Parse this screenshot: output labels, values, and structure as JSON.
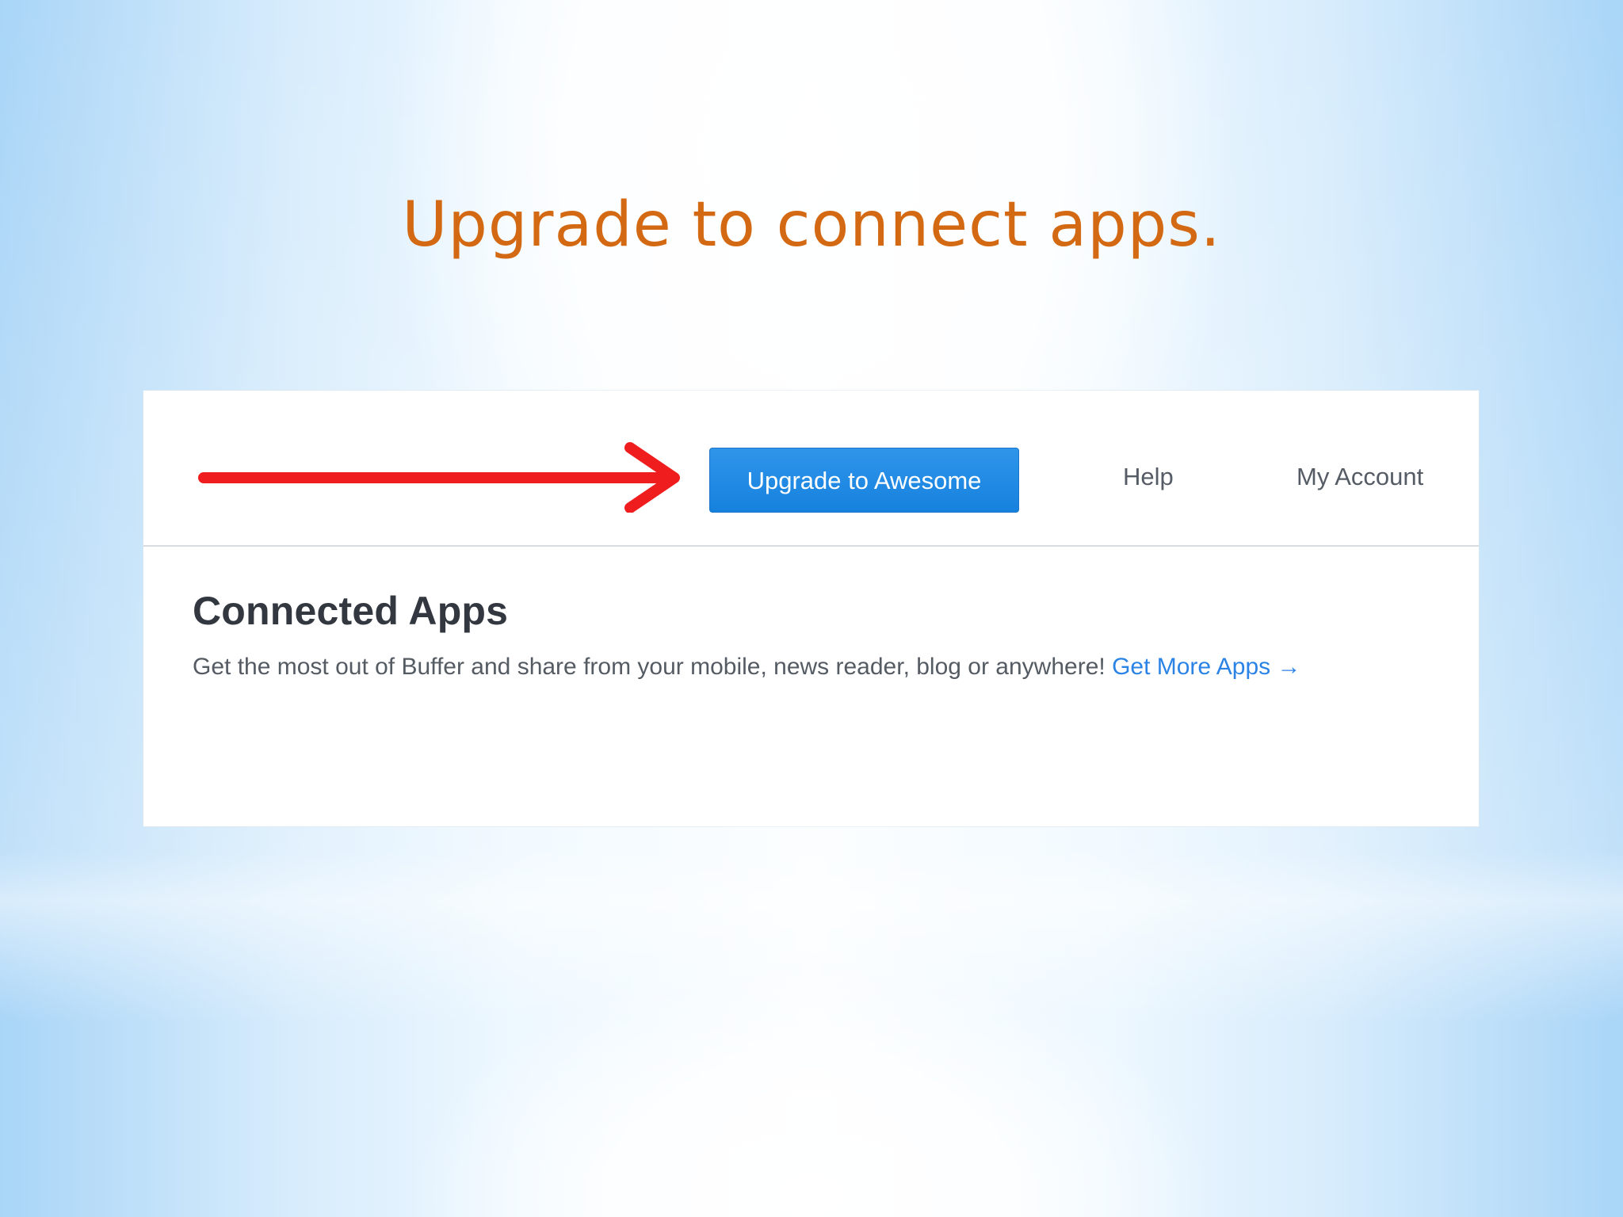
{
  "slide": {
    "title": "Upgrade to connect apps."
  },
  "toolbar": {
    "upgrade_label": "Upgrade to Awesome",
    "help_label": "Help",
    "account_label": "My Account"
  },
  "connected_apps": {
    "title": "Connected Apps",
    "description": "Get the most out of Buffer and share from your mobile, news reader, blog or anywhere!",
    "link_label": "Get More Apps →"
  },
  "annotation": {
    "arrow_icon": "red-arrow-icon",
    "arrow_color": "#ef1d1d"
  },
  "colors": {
    "title": "#d46913",
    "button": "#1f89e4",
    "link": "#2b83e6",
    "panel": "#ffffff"
  }
}
